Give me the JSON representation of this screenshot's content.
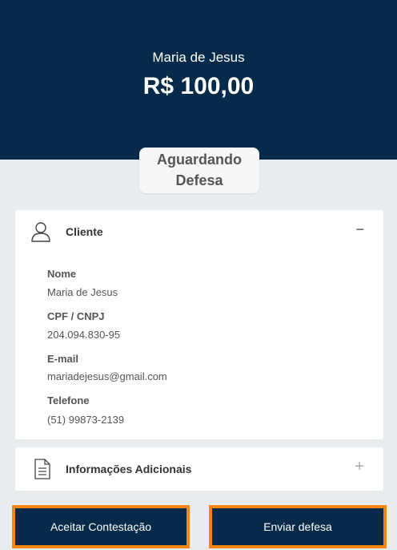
{
  "header": {
    "customer_name": "Maria de Jesus",
    "amount": "R$ 100,00",
    "background_color": "#062a4a"
  },
  "status": {
    "line1": "Aguardando",
    "line2": "Defesa"
  },
  "client_section": {
    "icon": "user-icon",
    "title": "Cliente",
    "toggle": "−",
    "fields": [
      {
        "label": "Nome",
        "value": "Maria de Jesus"
      },
      {
        "label": "CPF / CNPJ",
        "value": "204.094.830-95"
      },
      {
        "label": "E-mail",
        "value": "mariadejesus@gmail.com"
      },
      {
        "label": "Telefone",
        "value": "(51) 99873-2139"
      }
    ]
  },
  "info_section": {
    "icon": "document-icon",
    "title": "Informações Adicionais",
    "toggle": "+"
  },
  "actions": {
    "accept_label": "Aceitar Contestação",
    "send_label": "Enviar defesa",
    "border_color": "#f7850f"
  }
}
